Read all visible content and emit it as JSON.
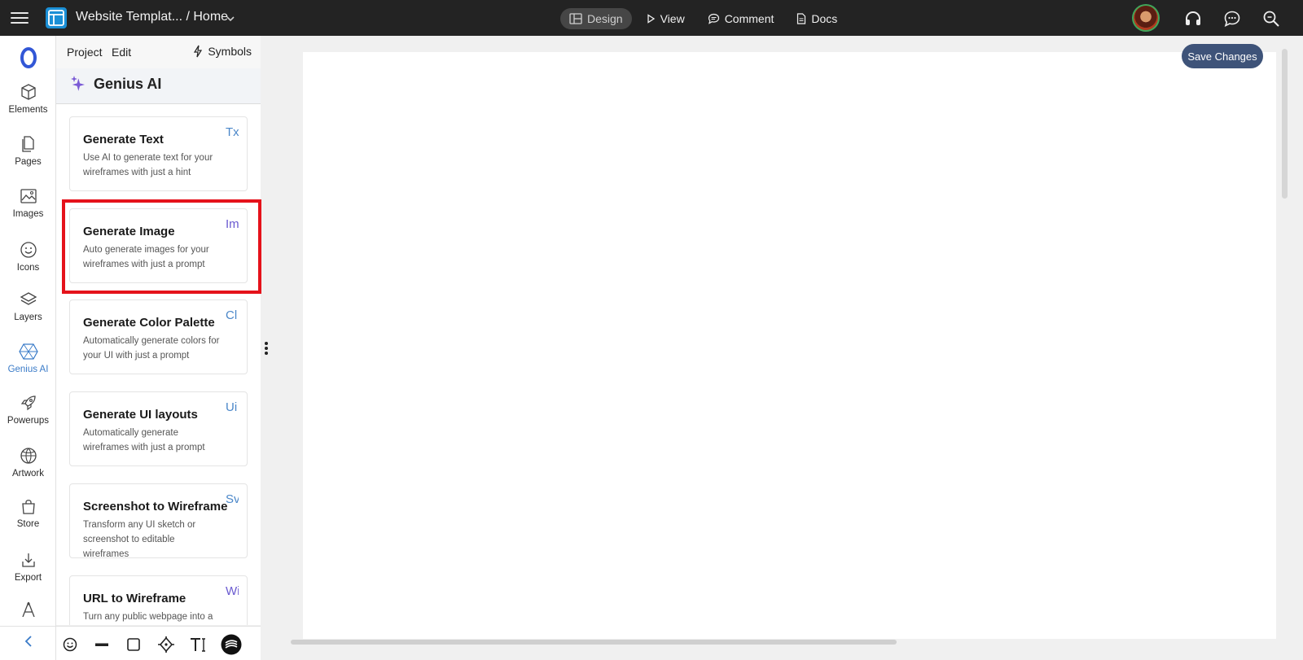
{
  "topbar": {
    "document_title": "Website Templat... / Home",
    "nav": [
      {
        "label": "Design",
        "icon": "layout-icon",
        "active": true
      },
      {
        "label": "View",
        "icon": "play-icon",
        "active": false
      },
      {
        "label": "Comment",
        "icon": "comment-icon",
        "active": false
      },
      {
        "label": "Docs",
        "icon": "document-icon",
        "active": false
      }
    ],
    "right_icons": [
      "avatar",
      "headphones-icon",
      "chat-icon",
      "search-icon"
    ]
  },
  "rail": {
    "items": [
      {
        "label": "Elements",
        "icon": "cube-icon"
      },
      {
        "label": "Pages",
        "icon": "pages-icon"
      },
      {
        "label": "Images",
        "icon": "image-icon"
      },
      {
        "label": "Icons",
        "icon": "smiley-icon"
      },
      {
        "label": "Layers",
        "icon": "layers-icon"
      },
      {
        "label": "Genius AI",
        "icon": "genius-icon",
        "active": true
      },
      {
        "label": "Powerups",
        "icon": "rocket-icon"
      },
      {
        "label": "Artwork",
        "icon": "globe-icon"
      },
      {
        "label": "Store",
        "icon": "bag-icon"
      },
      {
        "label": "Export",
        "icon": "export-icon"
      }
    ]
  },
  "panel": {
    "tabs": [
      "Project",
      "Edit"
    ],
    "symbols_label": "Symbols",
    "section_title": "Genius AI",
    "cards": [
      {
        "title": "Generate Text",
        "description": "Use AI to generate text for your wireframes with just a hint",
        "badge": "Tx",
        "badge_color": "#4b87c9"
      },
      {
        "title": "Generate Image",
        "description": "Auto generate images for your wireframes with just a prompt",
        "badge": "Im",
        "badge_color": "#6a5ad0"
      },
      {
        "title": "Generate Color Palette",
        "description": "Automatically generate colors for your UI with just a prompt",
        "badge": "Cl",
        "badge_color": "#4b87c9"
      },
      {
        "title": "Generate UI layouts",
        "description": "Automatically generate wireframes with just a prompt",
        "badge": "Ui",
        "badge_color": "#4b87c9"
      },
      {
        "title": "Screenshot to Wireframe",
        "description": "Transform any UI sketch or screenshot to editable wireframes",
        "badge": "Sv",
        "badge_color": "#4b87c9"
      },
      {
        "title": "URL to Wireframe",
        "description": "Turn any public webpage into a",
        "badge": "Wi",
        "badge_color": "#6a5ad0"
      }
    ],
    "toolbar": [
      "smiley-icon",
      "line-icon",
      "square-icon",
      "pen-tool-icon",
      "text-icon",
      "brand-icon"
    ]
  },
  "canvas": {
    "save_label": "Save Changes"
  },
  "colors": {
    "topbar": "#232323",
    "accent": "#3a7bc8",
    "save_button": "#3e5379",
    "highlight": "#e5121b"
  }
}
